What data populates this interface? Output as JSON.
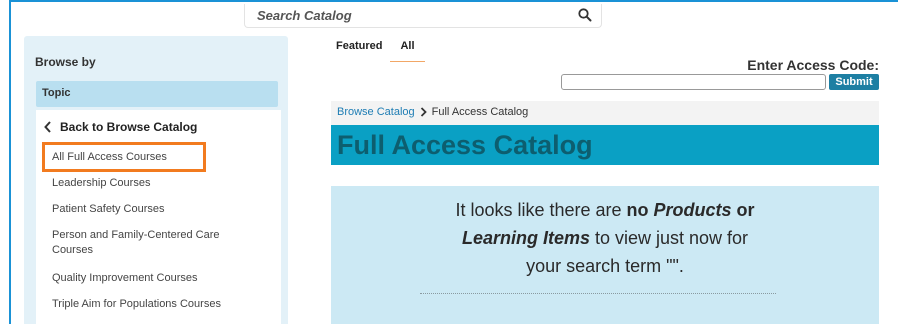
{
  "search": {
    "placeholder": "Search Catalog"
  },
  "sidebar": {
    "heading": "Browse by",
    "facet": "Topic",
    "back_label": "Back to Browse Catalog",
    "items": [
      {
        "label": "All Full Access Courses"
      },
      {
        "label": "Leadership Courses"
      },
      {
        "label": "Patient Safety Courses"
      },
      {
        "label": "Person and Family-Centered Care Courses"
      },
      {
        "label": "Quality Improvement Courses"
      },
      {
        "label": "Triple Aim for Populations Courses"
      }
    ],
    "selected_index": 0
  },
  "tabs": [
    {
      "label": "Featured",
      "active": false
    },
    {
      "label": "All",
      "active": true
    }
  ],
  "access": {
    "label": "Enter Access Code:",
    "value": "",
    "submit_label": "Submit"
  },
  "breadcrumb": {
    "root": "Browse Catalog",
    "current": "Full Access Catalog"
  },
  "page_title": "Full Access Catalog",
  "message": {
    "p1": "It looks like there are ",
    "b1": "no ",
    "i1": "Products",
    "b2": " or",
    "i2": "Learning Items",
    "p2": " to view just now for",
    "p3": "your search term \"\"."
  },
  "colors": {
    "accent": "#0aa0c4",
    "highlight": "#f27b1f",
    "link": "#1e7db4",
    "sidebar_bg": "#e3f1f8",
    "message_bg": "#cce9f4"
  }
}
